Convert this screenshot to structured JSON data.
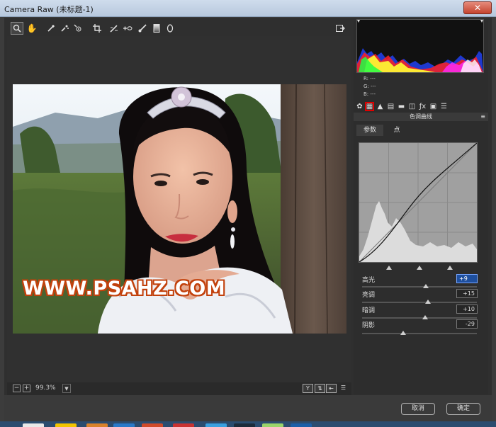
{
  "window": {
    "title": "Camera Raw (未标题-1)",
    "close_label": "✕"
  },
  "tools": [
    "zoom-tool",
    "hand-tool",
    "white-balance-tool",
    "color-sampler-tool",
    "target-adjust-tool",
    "crop-tool",
    "straighten-tool",
    "red-eye-tool",
    "adjustment-brush-tool",
    "graduated-filter-tool",
    "radial-filter-tool",
    "open-preferences"
  ],
  "preview": {
    "watermark": "WWW.PSAHZ.COM",
    "zoom": "99.3%"
  },
  "readout": {
    "r": "R:  ---",
    "g": "G:  ---",
    "b": "B:  ---"
  },
  "panel": {
    "title": "色调曲线",
    "tabs": [
      "参数",
      "点"
    ],
    "sliders": [
      {
        "label": "高光",
        "value": "+9",
        "level": 0.555
      },
      {
        "label": "亮调",
        "value": "+15",
        "level": 0.575
      },
      {
        "label": "暗调",
        "value": "+10",
        "level": 0.55
      },
      {
        "label": "阴影",
        "value": "-29",
        "level": 0.355
      }
    ]
  },
  "buttons": {
    "cancel": "取消",
    "ok": "确定"
  },
  "colors": {
    "accent": "#1e4f9e",
    "highlight_box": "#e00000",
    "watermark_stroke": "#c2410c"
  }
}
